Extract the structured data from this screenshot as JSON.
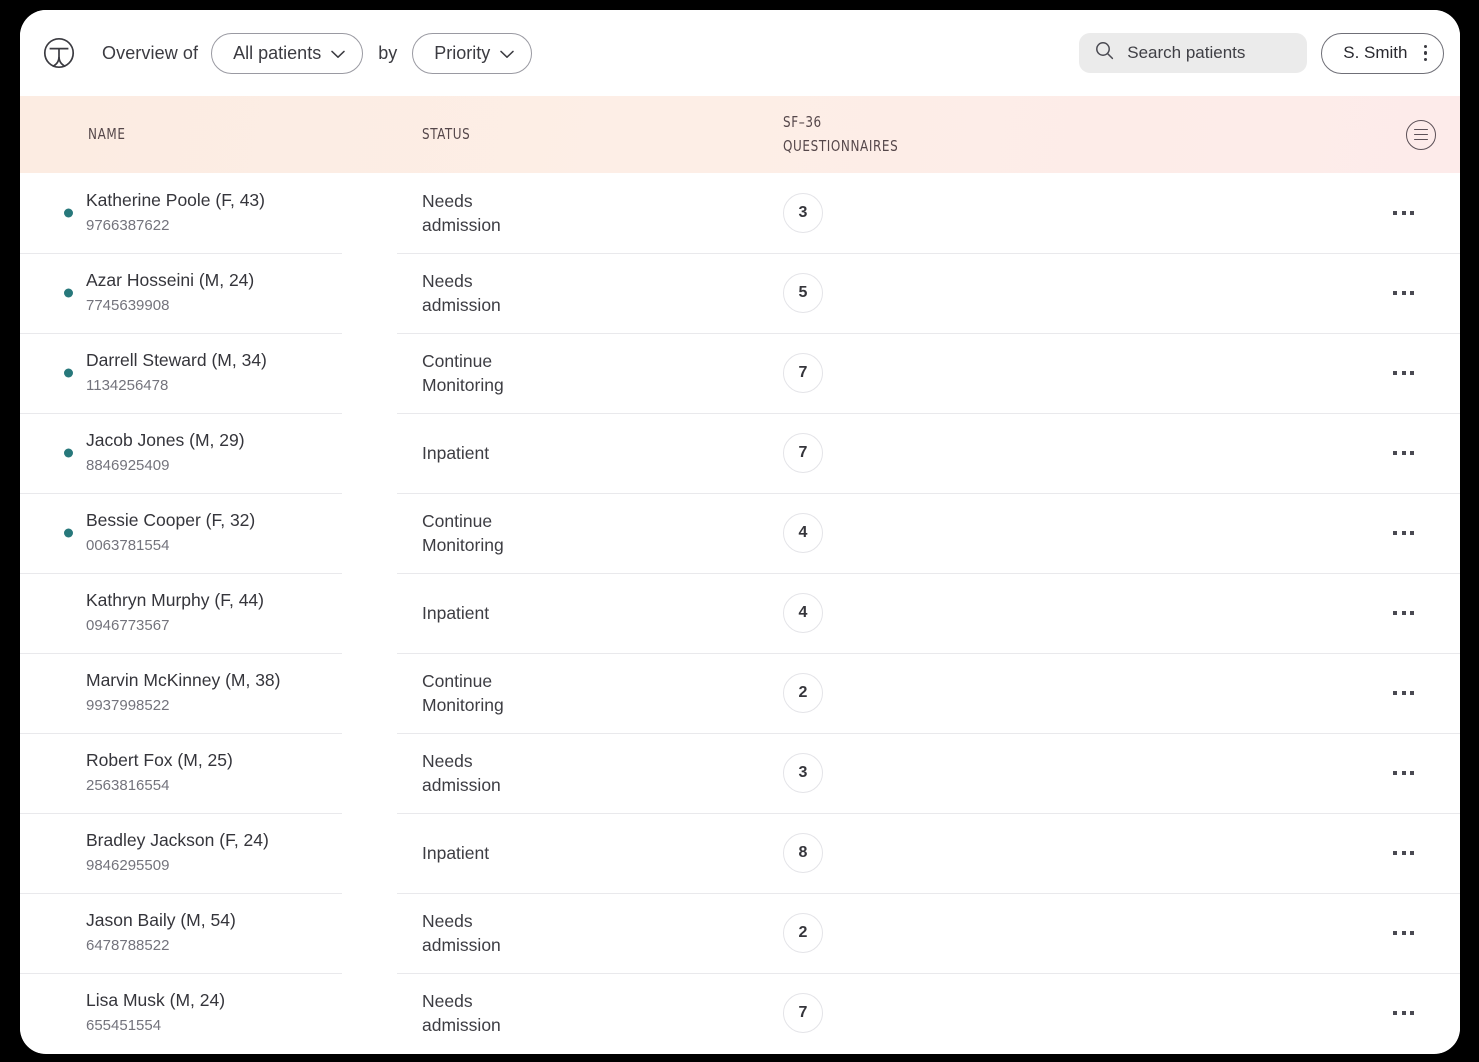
{
  "window": {
    "logo_icon": "patient-person-circle-icon"
  },
  "topbar": {
    "overview_label": "Overview of",
    "by_label": "by",
    "scope_filter": {
      "label": "All patients",
      "icon": "chevron-down-icon"
    },
    "sort_filter": {
      "label": "Priority",
      "icon": "chevron-down-icon"
    },
    "search": {
      "placeholder": "Search patients",
      "value": "",
      "icon": "search-icon"
    },
    "user": {
      "name": "S. Smith",
      "menu_icon": "vertical-dots-icon"
    }
  },
  "table": {
    "columns": {
      "name": "NAME",
      "status": "STATUS",
      "questionnaires": "SF–36\nQUESTIONNAIRES"
    },
    "header_menu_icon": "hamburger-menu-icon",
    "accent_teal": "#27787B",
    "header_gradient_from": "#FCECE2",
    "header_gradient_to": "#FDEBEA",
    "row_action_icon": "horizontal-dots-icon",
    "rows": [
      {
        "name": "Katherine Poole (F, 43)",
        "id": "9766387622",
        "status": "Needs\nadmission",
        "questionnaires": "3",
        "flagged": true
      },
      {
        "name": "Azar Hosseini (M, 24)",
        "id": "7745639908",
        "status": "Needs\nadmission",
        "questionnaires": "5",
        "flagged": true
      },
      {
        "name": "Darrell Steward (M, 34)",
        "id": "1134256478",
        "status": "Continue\nMonitoring",
        "questionnaires": "7",
        "flagged": true
      },
      {
        "name": "Jacob Jones (M, 29)",
        "id": "8846925409",
        "status": "Inpatient",
        "questionnaires": "7",
        "flagged": true
      },
      {
        "name": "Bessie Cooper (F, 32)",
        "id": "0063781554",
        "status": "Continue\nMonitoring",
        "questionnaires": "4",
        "flagged": true
      },
      {
        "name": "Kathryn Murphy (F, 44)",
        "id": "0946773567",
        "status": "Inpatient",
        "questionnaires": "4",
        "flagged": false
      },
      {
        "name": "Marvin McKinney (M, 38)",
        "id": "9937998522",
        "status": "Continue\nMonitoring",
        "questionnaires": "2",
        "flagged": false
      },
      {
        "name": "Robert Fox (M, 25)",
        "id": "2563816554",
        "status": "Needs\nadmission",
        "questionnaires": "3",
        "flagged": false
      },
      {
        "name": "Bradley Jackson (F, 24)",
        "id": "9846295509",
        "status": "Inpatient",
        "questionnaires": "8",
        "flagged": false
      },
      {
        "name": "Jason Baily (M, 54)",
        "id": "6478788522",
        "status": "Needs\nadmission",
        "questionnaires": "2",
        "flagged": false
      },
      {
        "name": "Lisa Musk (M, 24)",
        "id": "655451554",
        "status": "Needs\nadmission",
        "questionnaires": "7",
        "flagged": false
      }
    ]
  }
}
